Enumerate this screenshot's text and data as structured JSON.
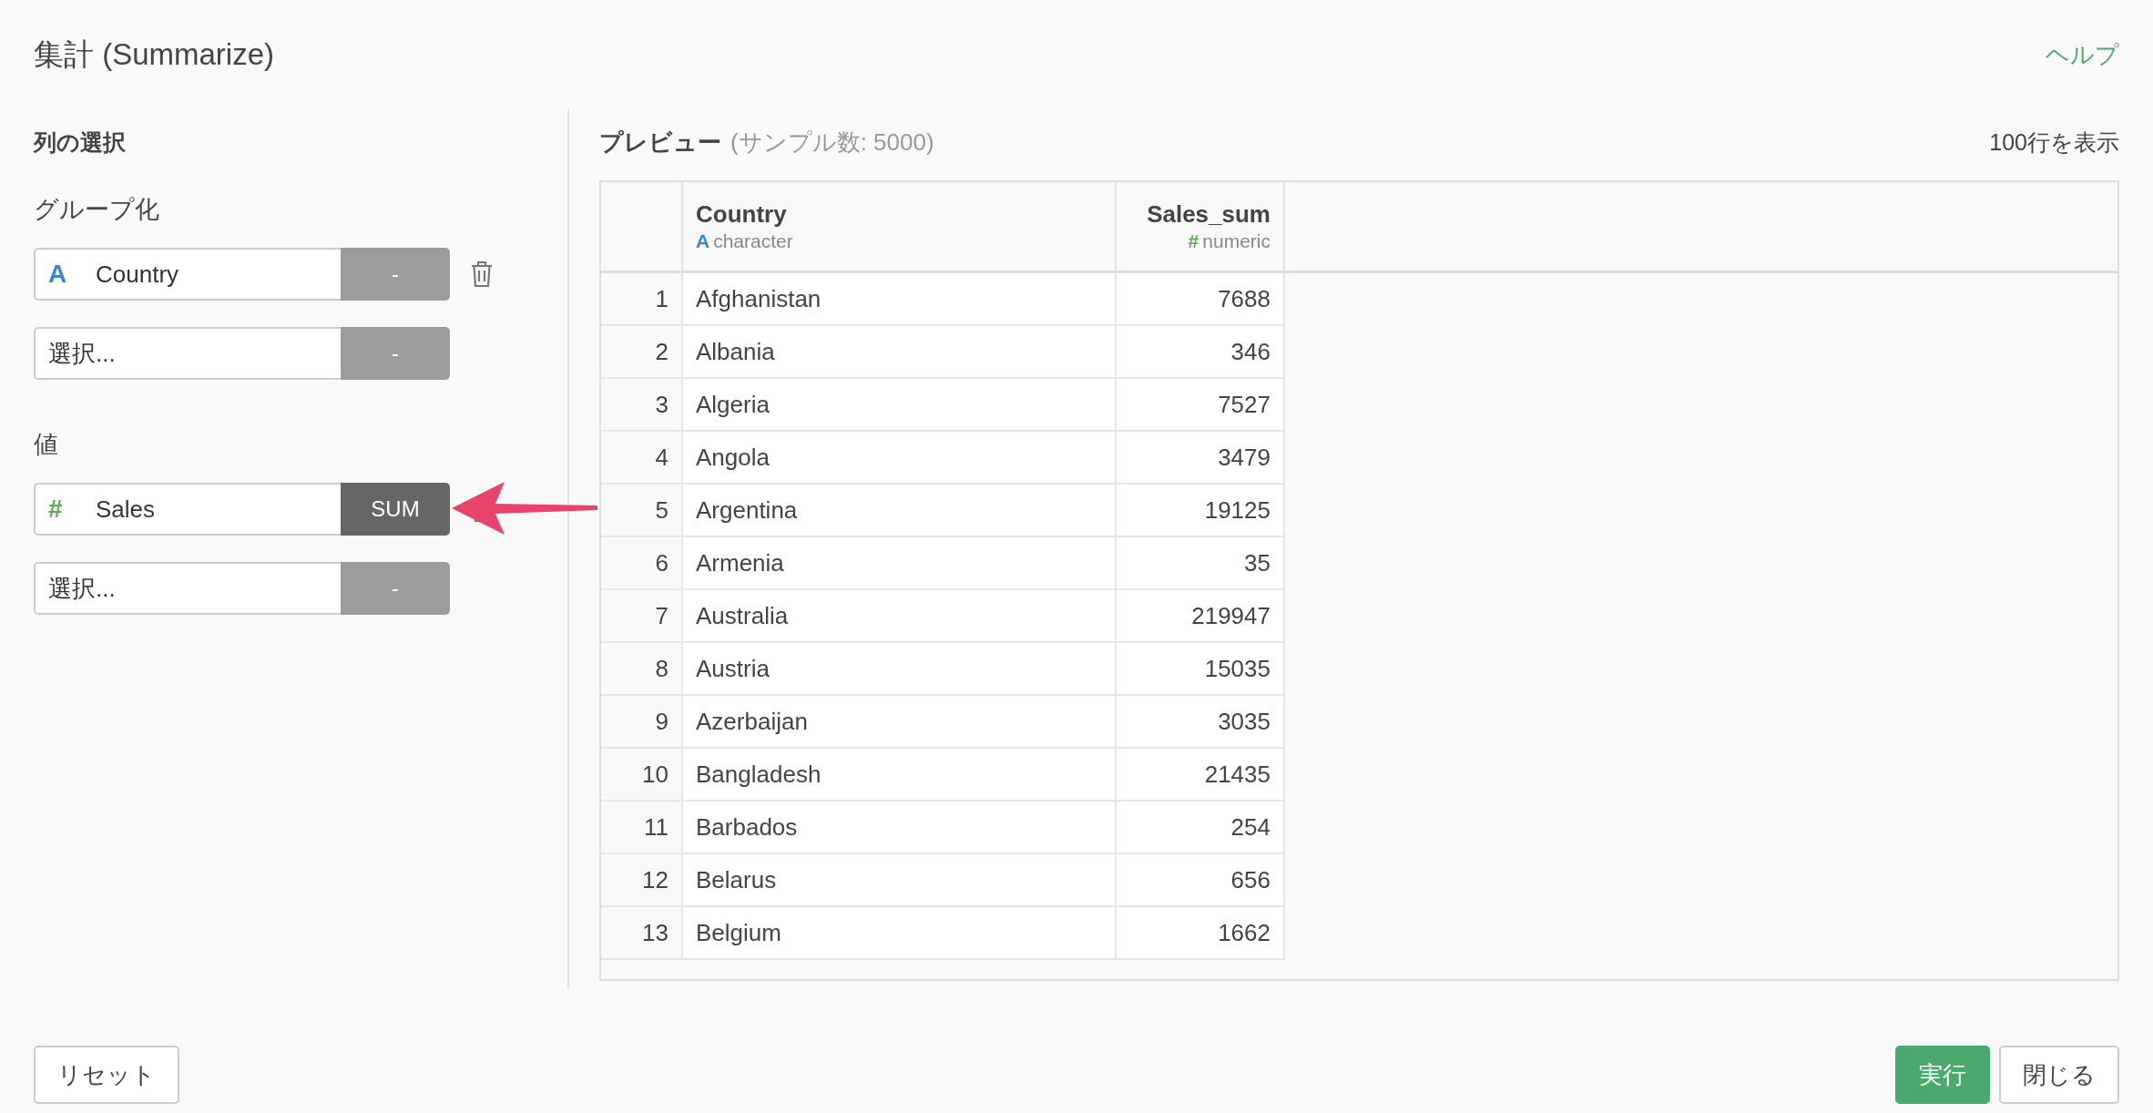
{
  "title": "集計 (Summarize)",
  "help_link": "ヘルプ",
  "column_selection": {
    "heading": "列の選択",
    "groups": [
      {
        "label": "グループ化",
        "fields": [
          {
            "kind": "column",
            "color": "#3a86d0",
            "type_icon": "A",
            "value": "Country",
            "function": {
              "label": "-",
              "active": false
            },
            "deletable": true
          },
          {
            "kind": "empty",
            "placeholder": "選択...",
            "function": {
              "label": "-",
              "active": false
            },
            "deletable": false
          }
        ]
      },
      {
        "label": "値",
        "fields": [
          {
            "kind": "column",
            "color": "#5aaa4e",
            "type_icon": "#",
            "value": "Sales",
            "function": {
              "label": "SUM",
              "active": true
            },
            "deletable": true
          },
          {
            "kind": "empty",
            "placeholder": "選択...",
            "function": {
              "label": "-",
              "active": false
            },
            "deletable": false
          }
        ]
      }
    ]
  },
  "preview": {
    "title": "プレビュー",
    "sample_note": "(サンプル数: 5000)",
    "rows_shown": "100行を表示",
    "columns": [
      {
        "name": "Country",
        "kind": "text",
        "color": "#3a86d0",
        "type_icon": "A",
        "type_label": "character"
      },
      {
        "name": "Sales_sum",
        "kind": "number",
        "color": "#5aaa4e",
        "type_icon": "#",
        "type_label": "numeric"
      }
    ],
    "rows": [
      {
        "number": "1",
        "cells": [
          "Afghanistan",
          "7688"
        ]
      },
      {
        "number": "2",
        "cells": [
          "Albania",
          "346"
        ]
      },
      {
        "number": "3",
        "cells": [
          "Algeria",
          "7527"
        ]
      },
      {
        "number": "4",
        "cells": [
          "Angola",
          "3479"
        ]
      },
      {
        "number": "5",
        "cells": [
          "Argentina",
          "19125"
        ]
      },
      {
        "number": "6",
        "cells": [
          "Armenia",
          "35"
        ]
      },
      {
        "number": "7",
        "cells": [
          "Australia",
          "219947"
        ]
      },
      {
        "number": "8",
        "cells": [
          "Austria",
          "15035"
        ]
      },
      {
        "number": "9",
        "cells": [
          "Azerbaijan",
          "3035"
        ]
      },
      {
        "number": "10",
        "cells": [
          "Bangladesh",
          "21435"
        ]
      },
      {
        "number": "11",
        "cells": [
          "Barbados",
          "254"
        ]
      },
      {
        "number": "12",
        "cells": [
          "Belarus",
          "656"
        ]
      },
      {
        "number": "13",
        "cells": [
          "Belgium",
          "1662"
        ]
      }
    ]
  },
  "footer": {
    "left": [
      {
        "label": "リセット",
        "kind": "default"
      }
    ],
    "right": [
      {
        "label": "実行",
        "kind": "primary"
      },
      {
        "label": "閉じる",
        "kind": "default"
      }
    ]
  }
}
